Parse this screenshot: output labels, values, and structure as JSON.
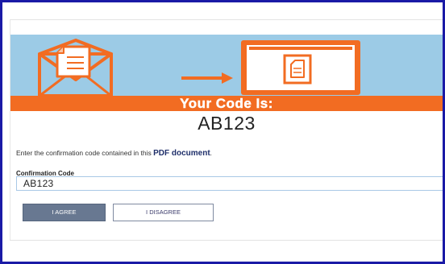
{
  "banner": {
    "heading": "Your Code Is:",
    "code": "AB123",
    "colors": {
      "sky": "#9ccbe6",
      "orange": "#f26c22"
    }
  },
  "instruction": {
    "text": "Enter the confirmation code contained in this ",
    "link": "PDF document",
    "suffix": "."
  },
  "form": {
    "label": "Confirmation Code",
    "value": "AB123"
  },
  "buttons": {
    "agree": "I AGREE",
    "disagree": "I DISAGREE"
  }
}
